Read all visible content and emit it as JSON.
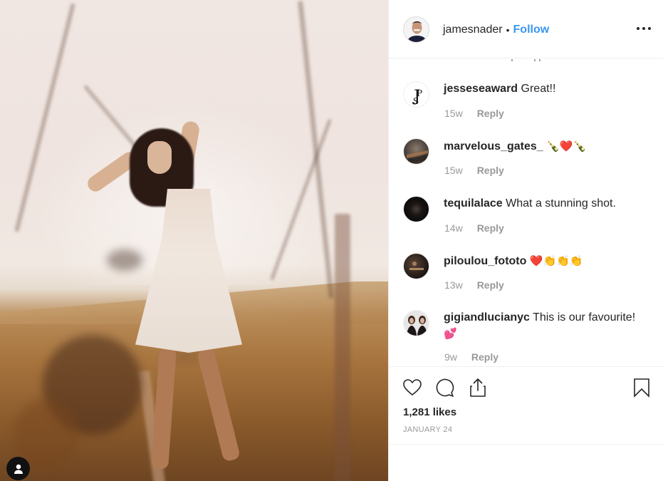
{
  "post": {
    "image_alt": "Woman in white lace dress standing in a golden field with blurred dried plants in foreground",
    "profile_badge_icon": "user-icon"
  },
  "header": {
    "username": "jamesnader",
    "separator": "•",
    "follow_label": "Follow",
    "more_icon": "more-options-icon"
  },
  "comments": [
    {
      "username": "jesseseaward",
      "text": "Great!!",
      "time": "15w",
      "reply_label": "Reply",
      "emoji": ""
    },
    {
      "username": "marvelous_gates_",
      "text": "",
      "time": "15w",
      "reply_label": "Reply",
      "emoji": "🍾❤️🍾"
    },
    {
      "username": "tequilalace",
      "text": "What a stunning shot.",
      "time": "14w",
      "reply_label": "Reply",
      "emoji": ""
    },
    {
      "username": "piloulou_fototo",
      "text": "",
      "time": "13w",
      "reply_label": "Reply",
      "emoji": "❤️👏👏👏"
    },
    {
      "username": "gigiandlucianyc",
      "text": "This is our favourite!",
      "time": "9w",
      "reply_label": "Reply",
      "emoji": "💕"
    }
  ],
  "actions": {
    "like_icon": "heart-icon",
    "comment_icon": "comment-icon",
    "share_icon": "share-icon",
    "save_icon": "bookmark-icon",
    "likes": "1,281 likes",
    "date": "JANUARY 24"
  },
  "colors": {
    "link_blue": "#3897f0",
    "text_primary": "#262626",
    "text_secondary": "#999999",
    "divider": "#efefef"
  }
}
